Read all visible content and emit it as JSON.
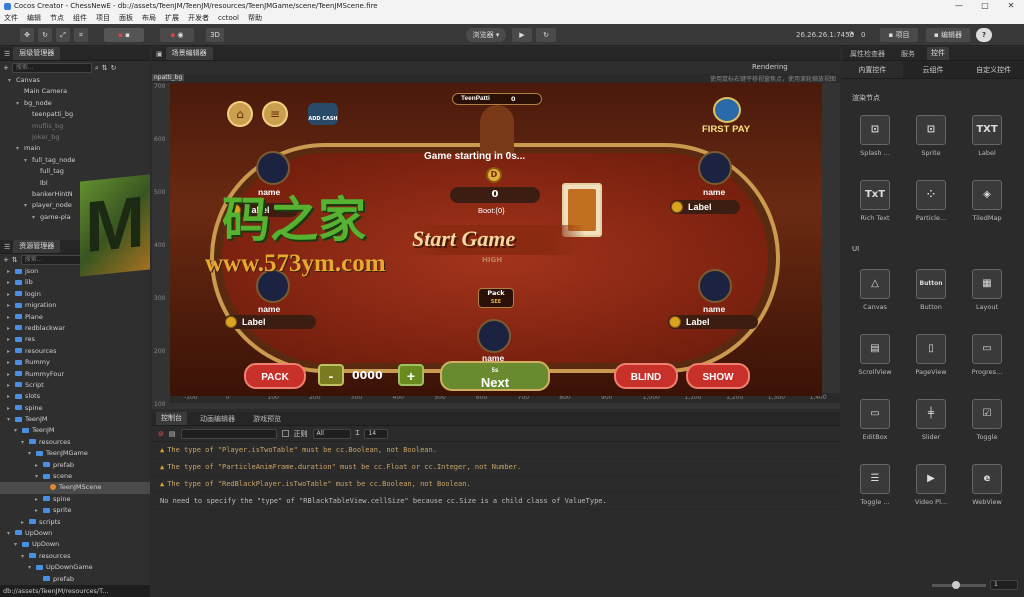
{
  "window": {
    "title": "Cocos Creator - ChessNewE - db://assets/TeenJM/TeenJM/resources/TeenJMGame/scene/TeenJMScene.fire"
  },
  "menu": [
    "文件",
    "编辑",
    "节点",
    "组件",
    "项目",
    "面板",
    "布局",
    "扩展",
    "开发者",
    "cctool",
    "帮助"
  ],
  "toolbar": {
    "three_d": "3D",
    "browser": "浏览器 ▾",
    "ip": "26.26.26.1:7456",
    "zero": "0",
    "project": "项目",
    "editor": "编辑器",
    "help": "?"
  },
  "hierarchy": {
    "tab": "层级管理器",
    "search_placeholder": "搜索...",
    "rows": [
      {
        "label": "Canvas",
        "indent": 1,
        "arrow": "▾",
        "dim": false
      },
      {
        "label": "Main Camera",
        "indent": 2,
        "arrow": "",
        "dim": false
      },
      {
        "label": "bg_node",
        "indent": 2,
        "arrow": "▾",
        "dim": false
      },
      {
        "label": "teenpatti_bg",
        "indent": 3,
        "arrow": "",
        "dim": false
      },
      {
        "label": "muflis_bg",
        "indent": 3,
        "arrow": "",
        "dim": true
      },
      {
        "label": "joker_bg",
        "indent": 3,
        "arrow": "",
        "dim": true
      },
      {
        "label": "main",
        "indent": 2,
        "arrow": "▾",
        "dim": false
      },
      {
        "label": "full_tag_node",
        "indent": 3,
        "arrow": "▾",
        "dim": false
      },
      {
        "label": "full_tag",
        "indent": 4,
        "arrow": "",
        "dim": false
      },
      {
        "label": "lbl",
        "indent": 4,
        "arrow": "",
        "dim": false
      },
      {
        "label": "bankerHintN",
        "indent": 3,
        "arrow": "",
        "dim": false
      },
      {
        "label": "player_node",
        "indent": 3,
        "arrow": "▾",
        "dim": false
      },
      {
        "label": "game-pla",
        "indent": 4,
        "arrow": "▾",
        "dim": false
      }
    ]
  },
  "assets": {
    "tab": "资源管理器",
    "search_placeholder": "搜索...",
    "rows": [
      {
        "label": "json",
        "indent": 1,
        "arrow": "▸",
        "sel": false
      },
      {
        "label": "lib",
        "indent": 1,
        "arrow": "▸",
        "sel": false
      },
      {
        "label": "login",
        "indent": 1,
        "arrow": "▸",
        "sel": false
      },
      {
        "label": "migration",
        "indent": 1,
        "arrow": "▸",
        "sel": false
      },
      {
        "label": "Plane",
        "indent": 1,
        "arrow": "▸",
        "sel": false
      },
      {
        "label": "redblackwar",
        "indent": 1,
        "arrow": "▸",
        "sel": false
      },
      {
        "label": "res",
        "indent": 1,
        "arrow": "▸",
        "sel": false
      },
      {
        "label": "resources",
        "indent": 1,
        "arrow": "▸",
        "sel": false
      },
      {
        "label": "Rummy",
        "indent": 1,
        "arrow": "▸",
        "sel": false
      },
      {
        "label": "RummyFour",
        "indent": 1,
        "arrow": "▸",
        "sel": false
      },
      {
        "label": "Script",
        "indent": 1,
        "arrow": "▸",
        "sel": false
      },
      {
        "label": "slots",
        "indent": 1,
        "arrow": "▸",
        "sel": false
      },
      {
        "label": "spine",
        "indent": 1,
        "arrow": "▸",
        "sel": false
      },
      {
        "label": "TeenJM",
        "indent": 1,
        "arrow": "▾",
        "sel": false
      },
      {
        "label": "TeenJM",
        "indent": 2,
        "arrow": "▾",
        "sel": false
      },
      {
        "label": "resources",
        "indent": 3,
        "arrow": "▾",
        "sel": false
      },
      {
        "label": "TeenJMGame",
        "indent": 4,
        "arrow": "▾",
        "sel": false
      },
      {
        "label": "prefab",
        "indent": 5,
        "arrow": "▸",
        "sel": false
      },
      {
        "label": "scene",
        "indent": 5,
        "arrow": "▾",
        "sel": false
      },
      {
        "label": "TeenJMScene",
        "indent": 6,
        "arrow": "",
        "sel": true
      },
      {
        "label": "spine",
        "indent": 5,
        "arrow": "▸",
        "sel": false
      },
      {
        "label": "sprite",
        "indent": 5,
        "arrow": "▸",
        "sel": false
      },
      {
        "label": "scripts",
        "indent": 3,
        "arrow": "▸",
        "sel": false
      },
      {
        "label": "UpDown",
        "indent": 1,
        "arrow": "▾",
        "sel": false
      },
      {
        "label": "UpDown",
        "indent": 2,
        "arrow": "▾",
        "sel": false
      },
      {
        "label": "resources",
        "indent": 3,
        "arrow": "▾",
        "sel": false
      },
      {
        "label": "UpDownGame",
        "indent": 4,
        "arrow": "▾",
        "sel": false
      },
      {
        "label": "prefab",
        "indent": 5,
        "arrow": "",
        "sel": false
      }
    ],
    "status": "db://assets/TeenJM/resources/T..."
  },
  "scene": {
    "tab": "场景编辑器",
    "rendering": "Rendering",
    "hint": "使用鼠标右键平移视窗焦点，使用滚轮缩放视图",
    "node_tag": "npatti_bg",
    "ruler_y": [
      "700",
      "600",
      "500",
      "400",
      "300",
      "200",
      "100"
    ],
    "ruler_x": [
      "-100",
      "0",
      "100",
      "200",
      "300",
      "400",
      "500",
      "600",
      "700",
      "800",
      "900",
      "1,000",
      "1,100",
      "1,200",
      "1,300",
      "1,400"
    ]
  },
  "game": {
    "teenpatti": "TeenPatti",
    "teenpatti_val": "0",
    "first_pay": "FIRST PAY",
    "add_cash": "ADD CASH",
    "status": "Game starting in 0s...",
    "pot": "0",
    "boot": "Boot:{0}",
    "start": "Start Game",
    "high": "HIGH",
    "pack_line1": "Pack",
    "pack_line2": "SEE",
    "name": "name",
    "label": "Label",
    "pack_btn": "PACK",
    "minus": "-",
    "bet": "0000",
    "plus": "+",
    "next_timer": "5s",
    "next": "Next",
    "blind": "BLIND",
    "show": "SHOW",
    "watermark_cn": "码之家",
    "watermark_url": "www.573ym.com"
  },
  "console": {
    "tabs": [
      "控制台",
      "动画编辑器",
      "游戏预览"
    ],
    "regex": "正则",
    "level": "All",
    "fontsize": "14",
    "lines": [
      {
        "type": "warn",
        "text": "The type of \"Player.isTwoTable\" must be cc.Boolean, not Boolean."
      },
      {
        "type": "warn",
        "text": "The type of \"ParticleAnimFrame.duration\" must be cc.Float or cc.Integer, not Number."
      },
      {
        "type": "warn",
        "text": "The type of \"RedBlackPlayer.isTwoTable\" must be cc.Boolean, not Boolean."
      },
      {
        "type": "info",
        "text": "No need to specify the \"type\" of \"RBlackTableView.cellSize\" because cc.Size is a child class of ValueType."
      }
    ]
  },
  "right": {
    "tabs": [
      "属性检查器",
      "服务",
      "控件"
    ],
    "subtabs": [
      "内置控件",
      "云组件",
      "自定义控件"
    ],
    "section_render": "渲染节点",
    "section_ui": "UI",
    "widgets_render": [
      {
        "icon": "⊡",
        "label": "Splash ..."
      },
      {
        "icon": "⊡",
        "label": "Sprite"
      },
      {
        "icon": "TXT",
        "label": "Label"
      },
      {
        "icon": "TxT",
        "label": "Rich Text"
      },
      {
        "icon": "⁘",
        "label": "Particle..."
      },
      {
        "icon": "◈",
        "label": "TiledMap"
      }
    ],
    "widgets_ui": [
      {
        "icon": "△",
        "label": "Canvas"
      },
      {
        "icon": "Button",
        "label": "Button"
      },
      {
        "icon": "▦",
        "label": "Layout"
      },
      {
        "icon": "▤",
        "label": "ScrollView"
      },
      {
        "icon": "▯",
        "label": "PageView"
      },
      {
        "icon": "▭",
        "label": "Progres..."
      },
      {
        "icon": "▭",
        "label": "EditBox"
      },
      {
        "icon": "╪",
        "label": "Slider"
      },
      {
        "icon": "☑",
        "label": "Toggle"
      },
      {
        "icon": "☰",
        "label": "Toggle ..."
      },
      {
        "icon": "▶",
        "label": "Video Pl..."
      },
      {
        "icon": "e",
        "label": "WebView"
      }
    ],
    "zoom_val": "1"
  }
}
